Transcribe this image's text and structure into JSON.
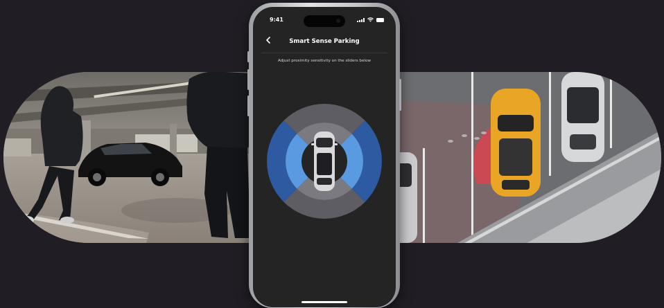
{
  "status_bar": {
    "time": "9:41"
  },
  "header": {
    "title": "Smart Sense Parking",
    "back_label": "<"
  },
  "instructions": "Adjust proximity sensitivity on the sliders below",
  "colors": {
    "zone_dark_blue": "#2d5aa0",
    "zone_light_blue": "#5a9ae0",
    "zone_gray": "#5e5d63",
    "zone_gray_light": "#7b7a80",
    "alert_red": "#e0424e",
    "car_yellow": "#e8a526",
    "background": "#201e24"
  },
  "icons": {
    "back": "chevron-left-icon",
    "signal": "cellular-signal-icon",
    "wifi": "wifi-icon",
    "battery": "battery-icon",
    "vehicle": "car-top-view-icon"
  }
}
